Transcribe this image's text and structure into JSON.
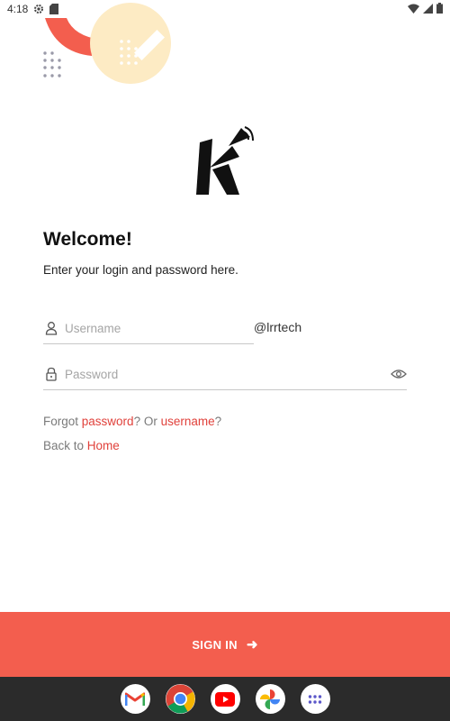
{
  "status_bar": {
    "time": "4:18",
    "left_icons": [
      "settings-gear-icon",
      "sd-card-icon"
    ],
    "right_icons": [
      "wifi-icon",
      "cell-signal-icon",
      "battery-icon"
    ]
  },
  "login": {
    "title": "Welcome!",
    "subtitle": "Enter your login and password here.",
    "username_placeholder": "Username",
    "username_value": "",
    "username_suffix": "@lrrtech",
    "password_placeholder": "Password",
    "password_value": "",
    "forgot_prefix": "Forgot ",
    "forgot_password_link": "password",
    "forgot_middle": "? Or ",
    "forgot_username_link": "username",
    "forgot_suffix": "?",
    "back_prefix": "Back to ",
    "home_link": "Home"
  },
  "signin_button": {
    "label": "SIGN IN",
    "arrow": "➜"
  },
  "colors": {
    "accent": "#f35e4e",
    "link": "#e0413b",
    "deco_yellow": "#fdebc4",
    "dock_bg": "#2b2b2b"
  },
  "dock": {
    "apps": [
      "gmail-icon",
      "chrome-icon",
      "youtube-icon",
      "photos-icon",
      "app-drawer-icon"
    ]
  }
}
